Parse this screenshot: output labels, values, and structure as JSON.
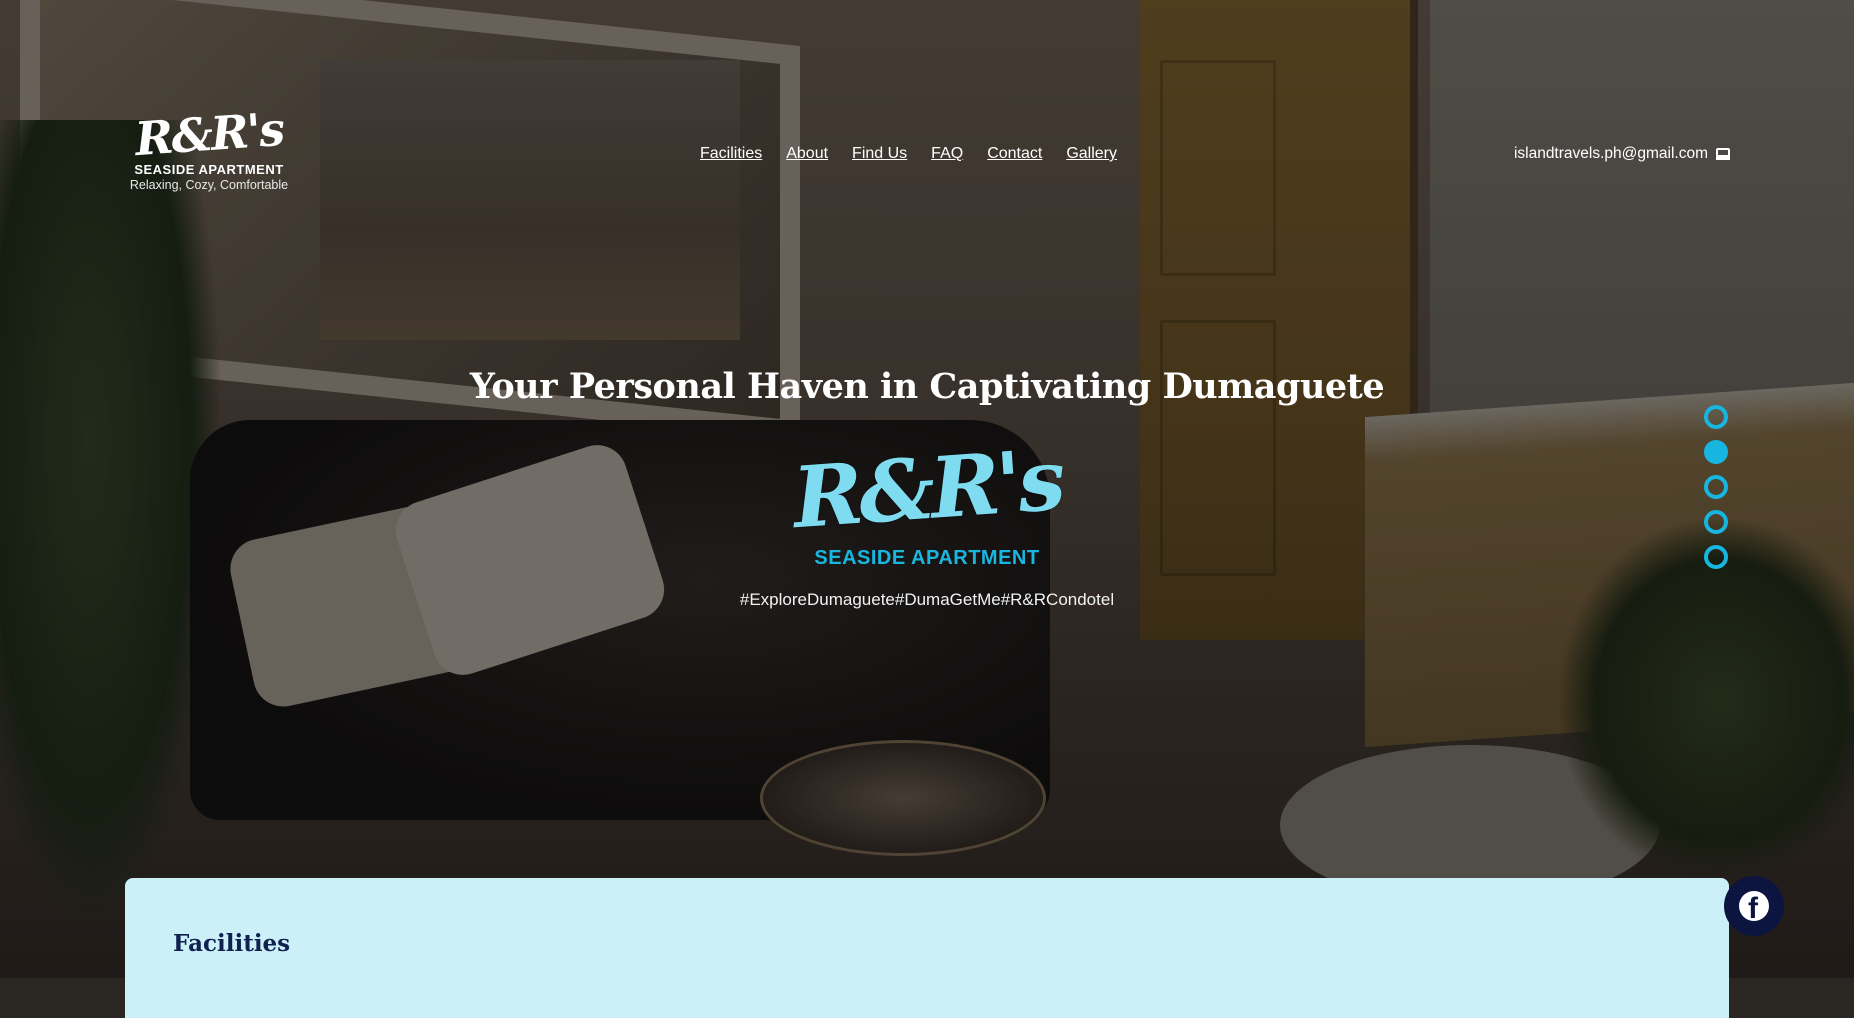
{
  "logo": {
    "script": "R&R's",
    "name": "SEASIDE APARTMENT",
    "tagline": "Relaxing, Cozy, Comfortable"
  },
  "nav": {
    "items": [
      {
        "label": "Facilities"
      },
      {
        "label": "About"
      },
      {
        "label": "Find Us"
      },
      {
        "label": "FAQ"
      },
      {
        "label": "Contact"
      },
      {
        "label": "Gallery"
      }
    ]
  },
  "contact": {
    "email": "islandtravels.ph@gmail.com",
    "icon": "inbox-icon"
  },
  "hero": {
    "headline": "Your Personal Haven in Captivating Dumaguete",
    "logo_script": "R&R's",
    "logo_name": "SEASIDE APARTMENT",
    "hashtags": "#ExploreDumaguete#DumaGetMe#R&RCondotel"
  },
  "slider": {
    "count": 5,
    "active_index": 1,
    "accent": "#17b6e0"
  },
  "facilities": {
    "title": "Facilities"
  },
  "social": {
    "facebook_icon": "facebook-icon"
  },
  "colors": {
    "accent": "#17b6e0",
    "card_bg": "#ccf0f8",
    "navy": "#0c1540"
  }
}
